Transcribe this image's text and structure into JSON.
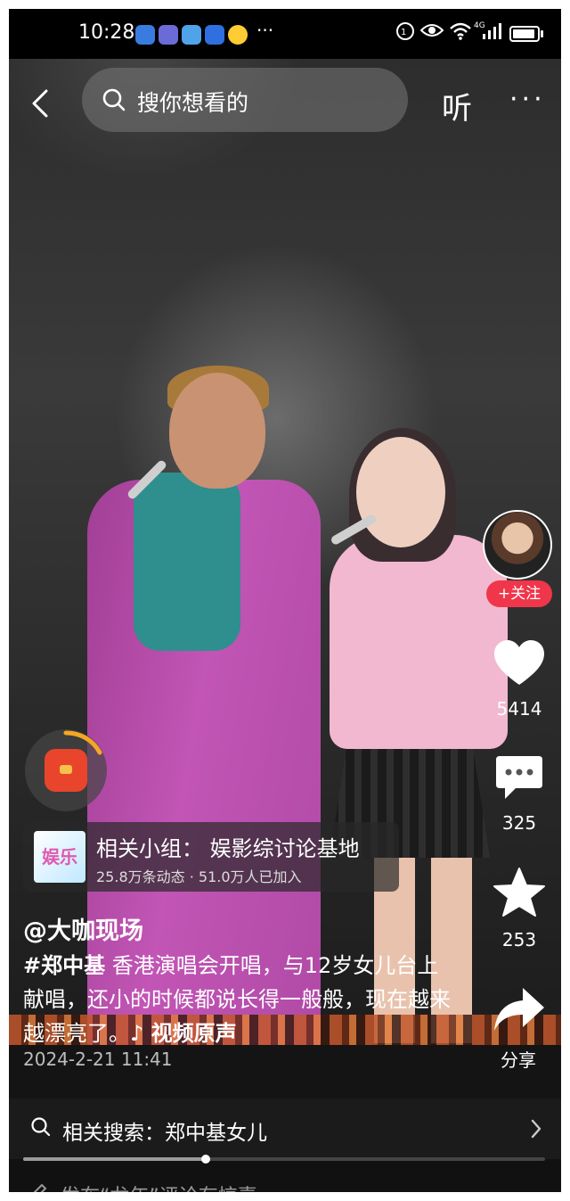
{
  "status_bar": {
    "time": "10:28",
    "network": "4G",
    "more_indicator": "···"
  },
  "top_nav": {
    "search_placeholder": "搜你想看的",
    "listen_label": "听",
    "more_label": "···"
  },
  "right_rail": {
    "follow_label": "+关注",
    "likes": "5414",
    "comments": "325",
    "favorites": "253",
    "share_label": "分享"
  },
  "group_card": {
    "title": "相关小组：  娱影综讨论基地",
    "stats": "25.8万条动态 · 51.0万人已加入",
    "thumb_text": "娱乐"
  },
  "post": {
    "author": "@大咖现场",
    "hashtag": "#郑中基",
    "caption": " 香港演唱会开唱，与12岁女儿台上献唱，还小的时候都说长得一般般，现在越来越漂亮了。",
    "music": "♪ 视频原声",
    "date": "2024-2-21 11:41"
  },
  "related_search": {
    "label": "相关搜索：郑中基女儿"
  },
  "playback": {
    "progress": 0.35
  },
  "comment_bar": {
    "placeholder": "发布“龙年”评论有惊喜"
  },
  "colors": {
    "follow_red": "#f0364a",
    "packet_red": "#e8452c",
    "ring_orange": "#f5a623"
  },
  "icons": [
    "back-icon",
    "search-icon",
    "heart-icon",
    "comment-icon",
    "star-icon",
    "share-icon",
    "red-packet-icon",
    "chevron-right-icon",
    "pen-icon"
  ]
}
